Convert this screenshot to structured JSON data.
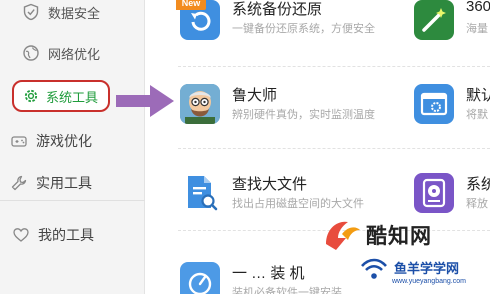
{
  "sidebar": {
    "items": [
      {
        "label": "数据安全",
        "icon": "shield-icon"
      },
      {
        "label": "网络优化",
        "icon": "globe-icon"
      },
      {
        "label": "系统工具",
        "icon": "gear-icon",
        "active": true
      },
      {
        "label": "游戏优化",
        "icon": "gamepad-icon"
      },
      {
        "label": "实用工具",
        "icon": "wrench-icon"
      }
    ],
    "favorites": {
      "label": "我的工具",
      "icon": "heart-icon"
    }
  },
  "tools": {
    "backup": {
      "name": "系统备份还原",
      "desc": "一键备份还原系统，方便安全",
      "badge": "New"
    },
    "ludashi": {
      "name": "鲁大师",
      "desc": "辨别硬件真伪，实时监测温度"
    },
    "bigfile": {
      "name": "查找大文件",
      "desc": "找出占用磁盘空间的大文件"
    },
    "partial_bottom": {
      "name": "一 … 装 机",
      "desc": "装机必备软件一键安装"
    },
    "right_col": [
      {
        "name": "360",
        "desc": "海量"
      },
      {
        "name": "默认",
        "desc": "将默"
      },
      {
        "name": "系统",
        "desc": "释放"
      }
    ]
  },
  "watermarks": {
    "kuzhi": "酷知网",
    "yuyang_cn": "鱼羊学学网",
    "yuyang_url": "www.yueyangbang.com"
  },
  "colors": {
    "active_border": "#c9302c",
    "active_text": "#1f9c3b",
    "arrow": "#9c6bb8",
    "badge": "#f28c1f",
    "tile_blue": "#3f8fe0",
    "tile_purple": "#7a55c7"
  }
}
